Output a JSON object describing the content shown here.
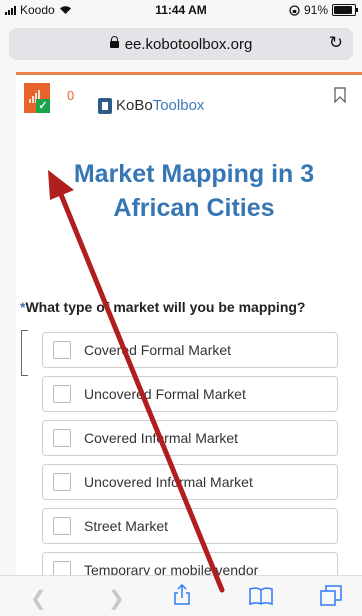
{
  "status": {
    "carrier": "Koodo",
    "time": "11:44 AM",
    "battery": "91%"
  },
  "browser": {
    "url": "ee.kobotoolbox.org"
  },
  "form": {
    "count": "0",
    "brand_bold": "KoBo",
    "brand_light": "Toolbox",
    "title": "Market Mapping in 3 African Cities",
    "question_required_mark": "*",
    "question": "What type of market will you be mapping?",
    "options": [
      {
        "label": "Covered Formal Market"
      },
      {
        "label": "Uncovered Formal Market"
      },
      {
        "label": "Covered Informal Market"
      },
      {
        "label": "Uncovered Informal Market"
      },
      {
        "label": "Street Market"
      },
      {
        "label": "Temporary or mobile vendor"
      }
    ]
  },
  "colors": {
    "accent": "#3776b4",
    "brand_orange": "#e8632a",
    "annotation_arrow": "#b01e1e"
  },
  "icons": [
    "signal-icon",
    "wifi-icon",
    "battery-icon",
    "lock-icon",
    "reload-icon",
    "bookmark-icon",
    "back-icon",
    "forward-icon",
    "share-icon",
    "bookmarks-icon",
    "tabs-icon"
  ]
}
